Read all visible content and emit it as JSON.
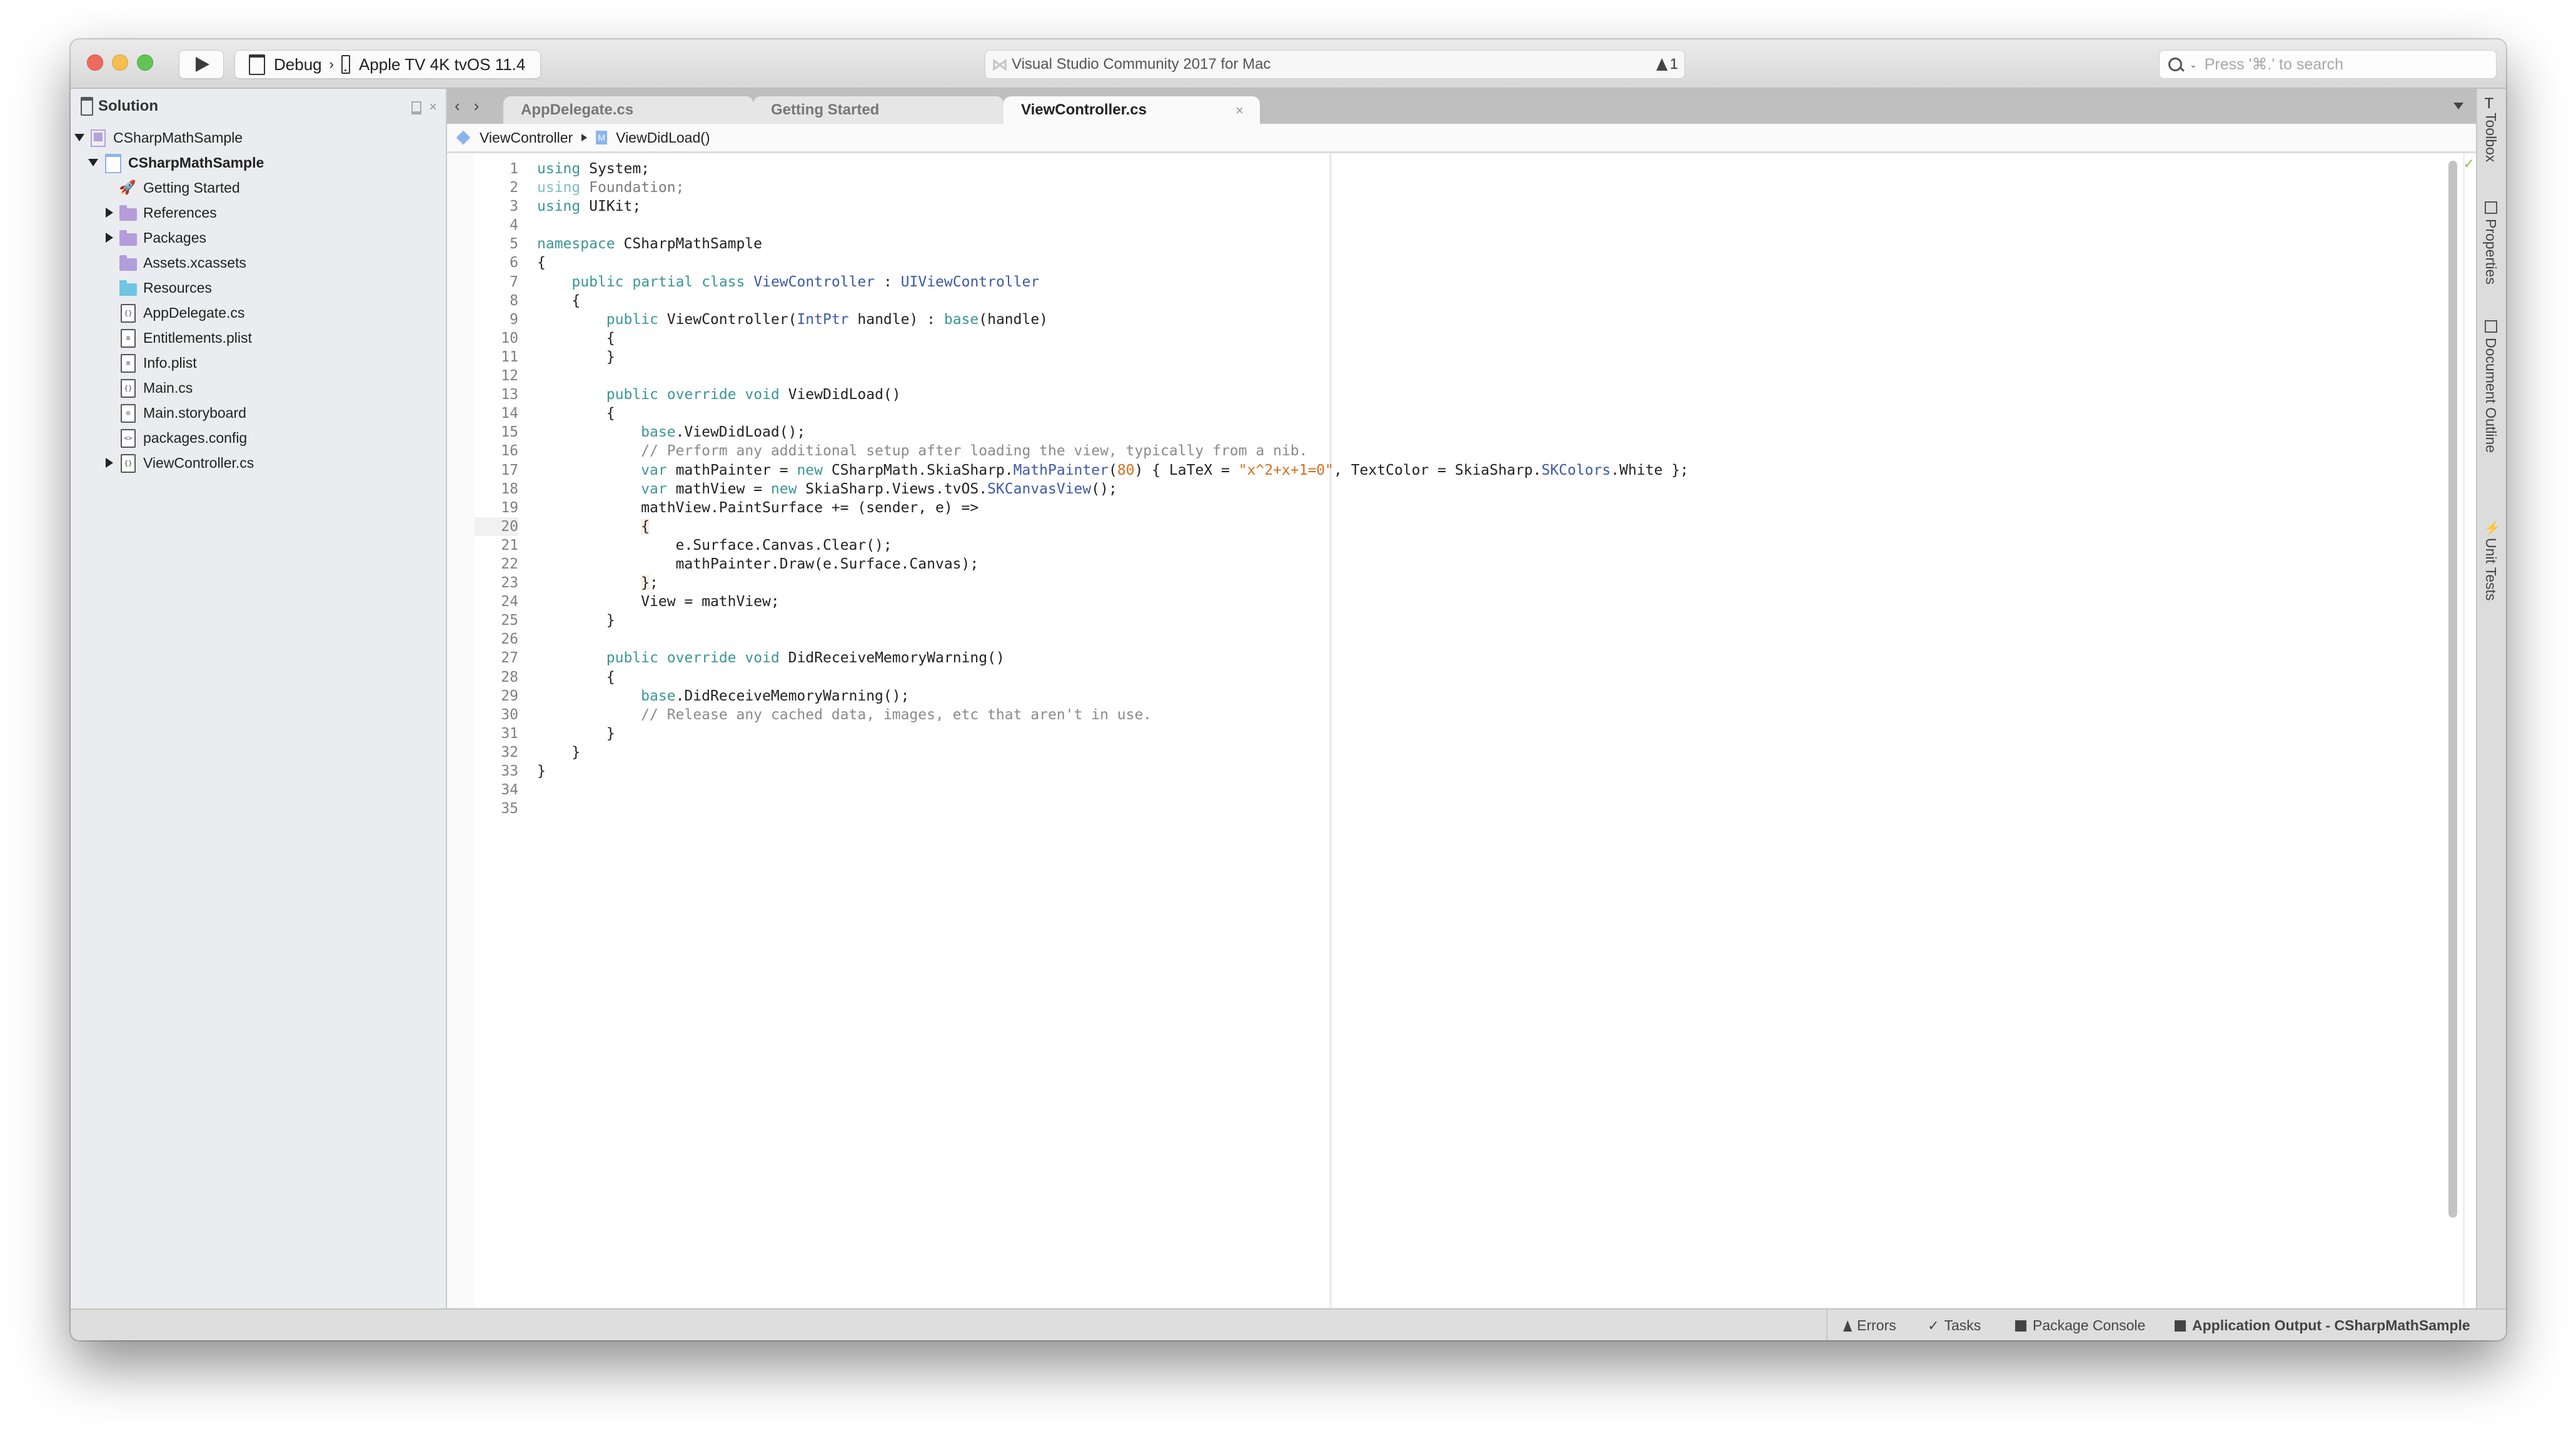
{
  "window": {
    "title": "Visual Studio Community 2017 for Mac",
    "warning_count": "1"
  },
  "toolbar": {
    "configuration": "Debug",
    "separator": "›",
    "device": "Apple TV 4K tvOS 11.4",
    "search_placeholder": "Press '⌘.' to search"
  },
  "sidebar": {
    "title": "Solution",
    "items": [
      {
        "label": "CSharpMathSample",
        "kind": "solution",
        "expanded": true
      },
      {
        "label": "CSharpMathSample",
        "kind": "project",
        "expanded": true
      },
      {
        "label": "Getting Started",
        "kind": "getting-started"
      },
      {
        "label": "References",
        "kind": "folder-purple",
        "expandable": true
      },
      {
        "label": "Packages",
        "kind": "folder-purple",
        "expandable": true
      },
      {
        "label": "Assets.xcassets",
        "kind": "folder-purple"
      },
      {
        "label": "Resources",
        "kind": "folder-blue"
      },
      {
        "label": "AppDelegate.cs",
        "kind": "cs-file"
      },
      {
        "label": "Entitlements.plist",
        "kind": "plist-file"
      },
      {
        "label": "Info.plist",
        "kind": "plist-file"
      },
      {
        "label": "Main.cs",
        "kind": "cs-file"
      },
      {
        "label": "Main.storyboard",
        "kind": "storyboard-file"
      },
      {
        "label": "packages.config",
        "kind": "config-file"
      },
      {
        "label": "ViewController.cs",
        "kind": "cs-file",
        "expandable": true
      }
    ]
  },
  "tabs": [
    {
      "label": "AppDelegate.cs",
      "active": false
    },
    {
      "label": "Getting Started",
      "active": false
    },
    {
      "label": "ViewController.cs",
      "active": true,
      "close": "×"
    }
  ],
  "breadcrumb": {
    "class_name": "ViewController",
    "class_icon_letter": "C",
    "method_name": "ViewDidLoad()",
    "method_icon_letter": "M"
  },
  "editor": {
    "current_line": 20,
    "lines": [
      "using System;",
      "using Foundation;",
      "using UIKit;",
      "",
      "namespace CSharpMathSample",
      "{",
      "    public partial class ViewController : UIViewController",
      "    {",
      "        public ViewController(IntPtr handle) : base(handle)",
      "        {",
      "        }",
      "",
      "        public override void ViewDidLoad()",
      "        {",
      "            base.ViewDidLoad();",
      "            // Perform any additional setup after loading the view, typically from a nib.",
      "            var mathPainter = new CSharpMath.SkiaSharp.MathPainter(80) { LaTeX = \"x^2+x+1=0\", TextColor = SkiaSharp.SKColors.White };",
      "            var mathView = new SkiaSharp.Views.tvOS.SKCanvasView();",
      "            mathView.PaintSurface += (sender, e) =>",
      "            {",
      "                e.Surface.Canvas.Clear();",
      "                mathPainter.Draw(e.Surface.Canvas);",
      "            };",
      "            View = mathView;",
      "        }",
      "",
      "        public override void DidReceiveMemoryWarning()",
      "        {",
      "            base.DidReceiveMemoryWarning();",
      "            // Release any cached data, images, etc that aren't in use.",
      "        }",
      "    }",
      "}",
      "",
      ""
    ]
  },
  "right_pads": [
    "Toolbox",
    "Properties",
    "Document Outline",
    "Unit Tests"
  ],
  "statusbar": {
    "errors": "Errors",
    "tasks": "Tasks",
    "package_console": "Package Console",
    "application_output": "Application Output - CSharpMathSample"
  },
  "colors": {
    "keyword": "#3b9696",
    "type": "#3c5aa6",
    "string": "#d4701c",
    "comment": "#8a8a8a",
    "traffic_close": "#ee6a5e",
    "traffic_min": "#f5be4f",
    "traffic_max": "#61c454"
  }
}
